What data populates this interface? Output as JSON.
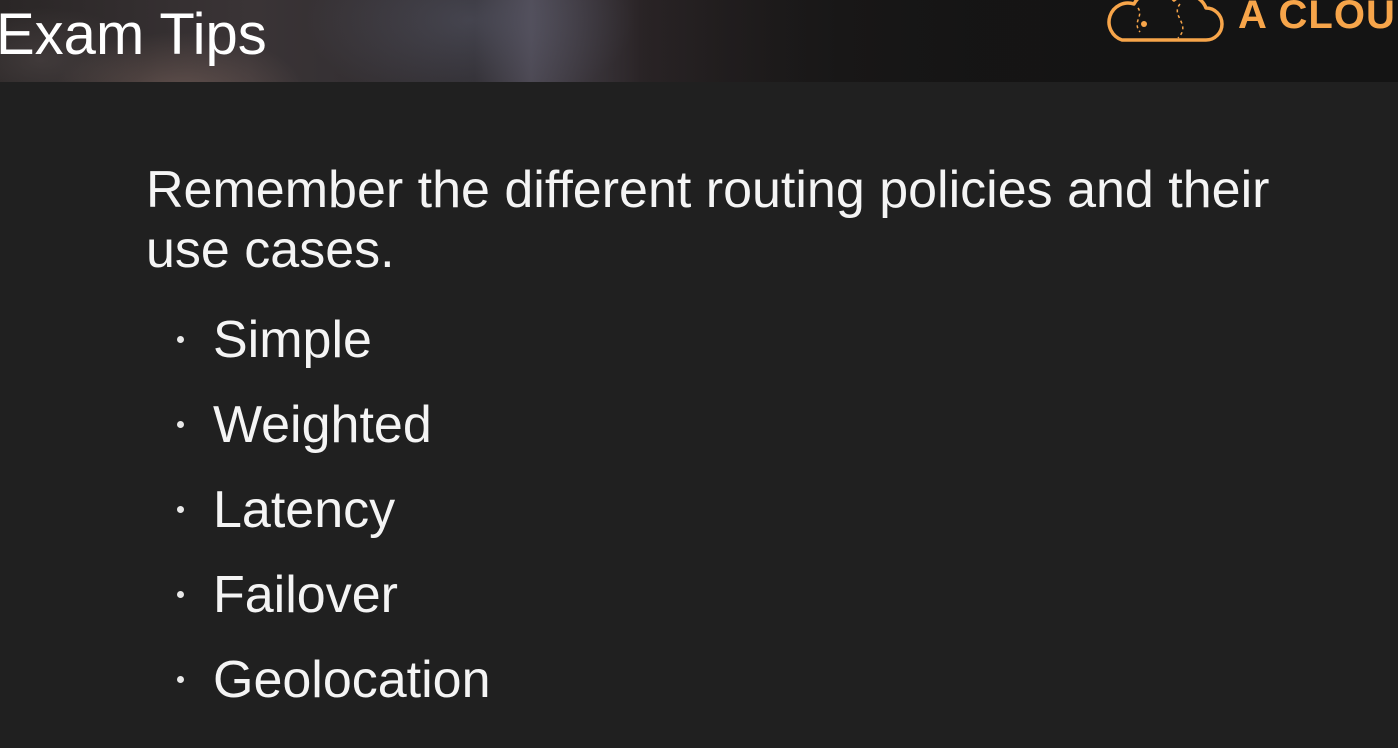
{
  "header": {
    "title": "Exam Tips",
    "logo_text": "A CLOUD",
    "logo_icon": "cloud-logo-icon",
    "accent_color": "#f7a54a"
  },
  "main": {
    "intro": "Remember the different routing policies and their use cases.",
    "bullets": [
      {
        "label": "Simple"
      },
      {
        "label": "Weighted"
      },
      {
        "label": "Latency"
      },
      {
        "label": "Failover"
      },
      {
        "label": "Geolocation"
      }
    ]
  }
}
